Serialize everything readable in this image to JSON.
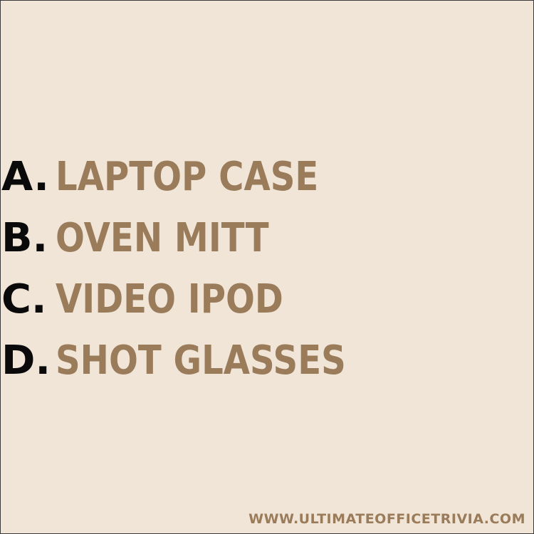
{
  "options": [
    {
      "letter": "A.",
      "text": "LAPTOP CASE"
    },
    {
      "letter": "B.",
      "text": "OVEN MITT"
    },
    {
      "letter": "C.",
      "text": "VIDEO IPOD"
    },
    {
      "letter": "D.",
      "text": "SHOT GLASSES"
    }
  ],
  "footer": {
    "url": "WWW.ULTIMATEOFFICETRIVIA.COM"
  },
  "colors": {
    "background": "#f0e5d7",
    "letter": "#0a0a0a",
    "answer": "#9a7b5a"
  }
}
